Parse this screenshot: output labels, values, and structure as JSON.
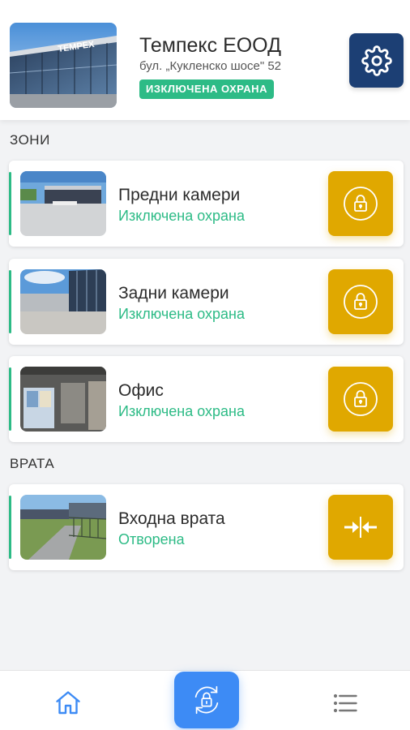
{
  "header": {
    "company_name": "Темпекс ЕООД",
    "address": "бул. „Кукленско шосе\" 52",
    "status": "ИЗКЛЮЧЕНА ОХРАНА",
    "photo_sign": "TEMPEX"
  },
  "sections": {
    "zones_title": "ЗОНИ",
    "doors_title": "ВРАТА"
  },
  "zones": [
    {
      "name": "Предни камери",
      "status": "Изключена охрана",
      "action_icon": "lock-icon"
    },
    {
      "name": "Задни камери",
      "status": "Изключена охрана",
      "action_icon": "lock-icon"
    },
    {
      "name": "Офис",
      "status": "Изключена охрана",
      "action_icon": "lock-icon"
    }
  ],
  "doors": [
    {
      "name": "Входна врата",
      "status": "Отворена",
      "action_icon": "close-gate-icon"
    }
  ],
  "bottom_nav": {
    "items": [
      "home-icon",
      "arm-toggle-icon",
      "menu-icon"
    ]
  },
  "colors": {
    "accent_green": "#2dbb86",
    "action_yellow": "#e0a800",
    "settings_blue": "#1c3f74",
    "nav_blue": "#3d8bf5"
  }
}
